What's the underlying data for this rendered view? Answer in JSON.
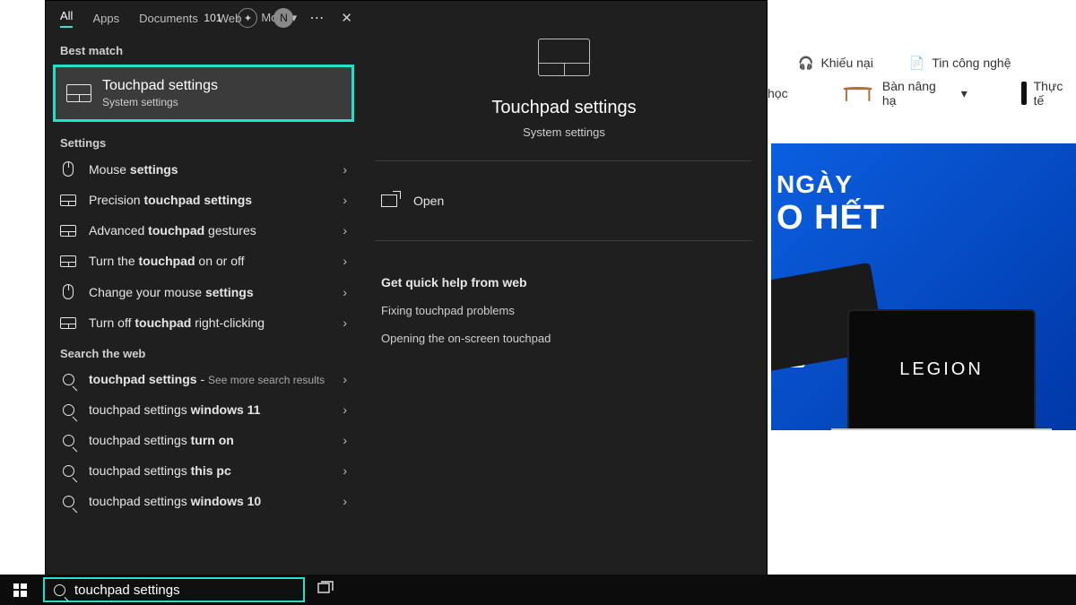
{
  "browser": {
    "links": [
      {
        "icon": "headset",
        "label": "Khiếu nại"
      },
      {
        "icon": "doc",
        "label": "Tin công nghệ"
      }
    ],
    "cats": [
      {
        "label": "học"
      },
      {
        "label": "Bàn nâng hạ"
      },
      {
        "label": "Thực tế"
      }
    ]
  },
  "ad": {
    "line1": "NGÀY",
    "line2": "O HẾT",
    "laptop_brand": "LEGION",
    "badge": "đ"
  },
  "tabs": {
    "all": "All",
    "apps": "Apps",
    "documents": "Documents",
    "web": "Web",
    "more": "More",
    "count": "101",
    "user_initial": "N"
  },
  "best": {
    "section": "Best match",
    "title": "Touchpad settings",
    "subtitle": "System settings"
  },
  "settings": {
    "section": "Settings",
    "items": [
      {
        "icon": "mouse",
        "pre": "Mouse ",
        "bold": "settings",
        "post": ""
      },
      {
        "icon": "tp",
        "pre": "Precision ",
        "bold": "touchpad settings",
        "post": ""
      },
      {
        "icon": "tp",
        "pre": "Advanced ",
        "bold": "touchpad",
        "post": " gestures"
      },
      {
        "icon": "tp",
        "pre": "Turn the ",
        "bold": "touchpad",
        "post": " on or off"
      },
      {
        "icon": "mouse",
        "pre": "Change your mouse ",
        "bold": "settings",
        "post": ""
      },
      {
        "icon": "tp",
        "pre": "Turn off ",
        "bold": "touchpad",
        "post": " right-clicking"
      }
    ]
  },
  "web": {
    "section": "Search the web",
    "items": [
      {
        "pre": "",
        "bold": "touchpad settings",
        "post": " - ",
        "suffix": "See more search results"
      },
      {
        "pre": "touchpad settings ",
        "bold": "windows 11",
        "post": ""
      },
      {
        "pre": "touchpad settings ",
        "bold": "turn on",
        "post": ""
      },
      {
        "pre": "touchpad settings ",
        "bold": "this pc",
        "post": ""
      },
      {
        "pre": "touchpad settings ",
        "bold": "windows 10",
        "post": ""
      }
    ]
  },
  "preview": {
    "title": "Touchpad settings",
    "subtitle": "System settings",
    "open": "Open",
    "help": "Get quick help from web",
    "links": [
      "Fixing touchpad problems",
      "Opening the on-screen touchpad"
    ]
  },
  "taskbar": {
    "search_value": "touchpad settings"
  }
}
